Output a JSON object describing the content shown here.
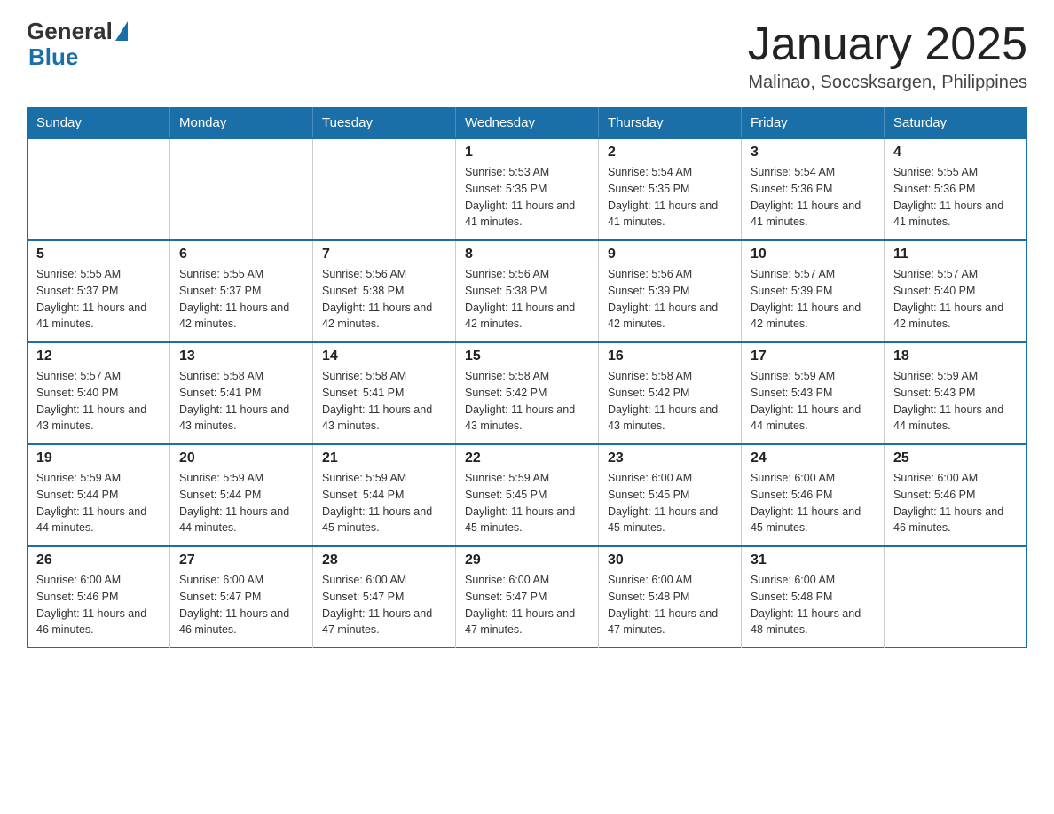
{
  "header": {
    "logo_general": "General",
    "logo_blue": "Blue",
    "month_title": "January 2025",
    "location": "Malinao, Soccsksargen, Philippines"
  },
  "days_of_week": [
    "Sunday",
    "Monday",
    "Tuesday",
    "Wednesday",
    "Thursday",
    "Friday",
    "Saturday"
  ],
  "weeks": [
    [
      {
        "day": "",
        "info": ""
      },
      {
        "day": "",
        "info": ""
      },
      {
        "day": "",
        "info": ""
      },
      {
        "day": "1",
        "info": "Sunrise: 5:53 AM\nSunset: 5:35 PM\nDaylight: 11 hours and 41 minutes."
      },
      {
        "day": "2",
        "info": "Sunrise: 5:54 AM\nSunset: 5:35 PM\nDaylight: 11 hours and 41 minutes."
      },
      {
        "day": "3",
        "info": "Sunrise: 5:54 AM\nSunset: 5:36 PM\nDaylight: 11 hours and 41 minutes."
      },
      {
        "day": "4",
        "info": "Sunrise: 5:55 AM\nSunset: 5:36 PM\nDaylight: 11 hours and 41 minutes."
      }
    ],
    [
      {
        "day": "5",
        "info": "Sunrise: 5:55 AM\nSunset: 5:37 PM\nDaylight: 11 hours and 41 minutes."
      },
      {
        "day": "6",
        "info": "Sunrise: 5:55 AM\nSunset: 5:37 PM\nDaylight: 11 hours and 42 minutes."
      },
      {
        "day": "7",
        "info": "Sunrise: 5:56 AM\nSunset: 5:38 PM\nDaylight: 11 hours and 42 minutes."
      },
      {
        "day": "8",
        "info": "Sunrise: 5:56 AM\nSunset: 5:38 PM\nDaylight: 11 hours and 42 minutes."
      },
      {
        "day": "9",
        "info": "Sunrise: 5:56 AM\nSunset: 5:39 PM\nDaylight: 11 hours and 42 minutes."
      },
      {
        "day": "10",
        "info": "Sunrise: 5:57 AM\nSunset: 5:39 PM\nDaylight: 11 hours and 42 minutes."
      },
      {
        "day": "11",
        "info": "Sunrise: 5:57 AM\nSunset: 5:40 PM\nDaylight: 11 hours and 42 minutes."
      }
    ],
    [
      {
        "day": "12",
        "info": "Sunrise: 5:57 AM\nSunset: 5:40 PM\nDaylight: 11 hours and 43 minutes."
      },
      {
        "day": "13",
        "info": "Sunrise: 5:58 AM\nSunset: 5:41 PM\nDaylight: 11 hours and 43 minutes."
      },
      {
        "day": "14",
        "info": "Sunrise: 5:58 AM\nSunset: 5:41 PM\nDaylight: 11 hours and 43 minutes."
      },
      {
        "day": "15",
        "info": "Sunrise: 5:58 AM\nSunset: 5:42 PM\nDaylight: 11 hours and 43 minutes."
      },
      {
        "day": "16",
        "info": "Sunrise: 5:58 AM\nSunset: 5:42 PM\nDaylight: 11 hours and 43 minutes."
      },
      {
        "day": "17",
        "info": "Sunrise: 5:59 AM\nSunset: 5:43 PM\nDaylight: 11 hours and 44 minutes."
      },
      {
        "day": "18",
        "info": "Sunrise: 5:59 AM\nSunset: 5:43 PM\nDaylight: 11 hours and 44 minutes."
      }
    ],
    [
      {
        "day": "19",
        "info": "Sunrise: 5:59 AM\nSunset: 5:44 PM\nDaylight: 11 hours and 44 minutes."
      },
      {
        "day": "20",
        "info": "Sunrise: 5:59 AM\nSunset: 5:44 PM\nDaylight: 11 hours and 44 minutes."
      },
      {
        "day": "21",
        "info": "Sunrise: 5:59 AM\nSunset: 5:44 PM\nDaylight: 11 hours and 45 minutes."
      },
      {
        "day": "22",
        "info": "Sunrise: 5:59 AM\nSunset: 5:45 PM\nDaylight: 11 hours and 45 minutes."
      },
      {
        "day": "23",
        "info": "Sunrise: 6:00 AM\nSunset: 5:45 PM\nDaylight: 11 hours and 45 minutes."
      },
      {
        "day": "24",
        "info": "Sunrise: 6:00 AM\nSunset: 5:46 PM\nDaylight: 11 hours and 45 minutes."
      },
      {
        "day": "25",
        "info": "Sunrise: 6:00 AM\nSunset: 5:46 PM\nDaylight: 11 hours and 46 minutes."
      }
    ],
    [
      {
        "day": "26",
        "info": "Sunrise: 6:00 AM\nSunset: 5:46 PM\nDaylight: 11 hours and 46 minutes."
      },
      {
        "day": "27",
        "info": "Sunrise: 6:00 AM\nSunset: 5:47 PM\nDaylight: 11 hours and 46 minutes."
      },
      {
        "day": "28",
        "info": "Sunrise: 6:00 AM\nSunset: 5:47 PM\nDaylight: 11 hours and 47 minutes."
      },
      {
        "day": "29",
        "info": "Sunrise: 6:00 AM\nSunset: 5:47 PM\nDaylight: 11 hours and 47 minutes."
      },
      {
        "day": "30",
        "info": "Sunrise: 6:00 AM\nSunset: 5:48 PM\nDaylight: 11 hours and 47 minutes."
      },
      {
        "day": "31",
        "info": "Sunrise: 6:00 AM\nSunset: 5:48 PM\nDaylight: 11 hours and 48 minutes."
      },
      {
        "day": "",
        "info": ""
      }
    ]
  ]
}
